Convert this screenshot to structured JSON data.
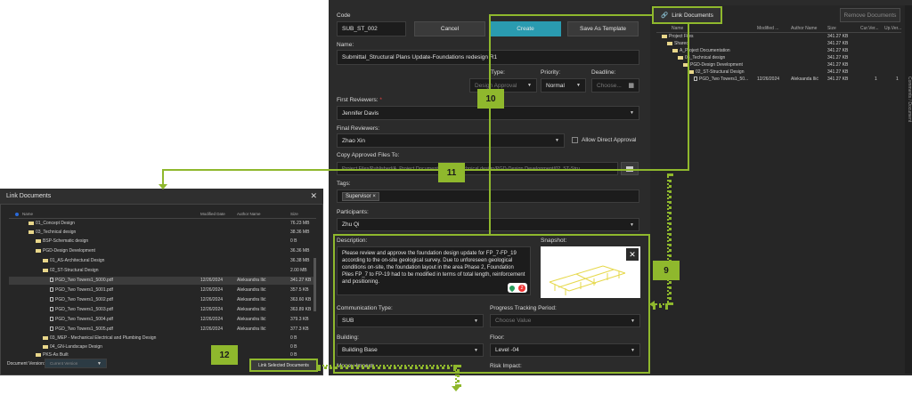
{
  "main": {
    "code_label": "Code",
    "code_value": "SUB_ST_002",
    "cancel": "Cancel",
    "create": "Create",
    "save_template": "Save As Template",
    "name_label": "Name:",
    "name_value": "Submittal_Structural Plans Update-Foundations redesign R1",
    "type_label": "Type:",
    "type_value": "Design Approval",
    "priority_label": "Priority:",
    "priority_value": "Normal",
    "deadline_label": "Deadline:",
    "deadline_value": "Choose...",
    "first_rev_label": "First Reviewers:",
    "first_rev_value": "Jennifer Davis",
    "final_rev_label": "Final Reviewers:",
    "final_rev_value": "Zhao  Xin",
    "allow_direct": "Allow Direct Approval",
    "copy_label": "Copy Approved Files To:",
    "copy_value": "Project Files/Published/A_Project Documentation/03_Technical design/PGD-Design Development/02_ST-Stru",
    "tags_label": "Tags:",
    "tag1": "Supervisor",
    "participants_label": "Participants:",
    "participants_value": "Zhu  Qi",
    "desc_label": "Description:",
    "desc_text": "Please review and approve the foundation design update for FP_7-FP_19 according to the on-site geological survey. Due to unforeseen geological conditions on-site, the foundation layout in the area Phase 2, Foundation Piles FP_7 to FP-19 had to be modified in terms of total length, reinforcement and positioning.",
    "snapshot_label": "Snapshot:",
    "comm_label": "Communication Type:",
    "comm_value": "SUB",
    "progress_label": "Progress Tracking Period:",
    "progress_value": "Choose Value",
    "building_label": "Building:",
    "building_value": "Building Base",
    "floor_label": "Floor:",
    "floor_value": "Level -04",
    "money_label": "Money Impact:",
    "risk_label": "Risk Impact:",
    "pin_count": "2"
  },
  "right": {
    "link_btn": "Link Documents",
    "remove_btn": "Remove Documents",
    "columns": [
      "Name",
      "Modified ...",
      "Author Name",
      "Size",
      "Cur.Ver...",
      "Up.Ver..."
    ],
    "rows": [
      {
        "name": "Project Files",
        "mod": "",
        "author": "",
        "size": "341.27 KB",
        "cur": "",
        "up": ""
      },
      {
        "name": "Shared",
        "mod": "",
        "author": "",
        "size": "341.27 KB",
        "cur": "",
        "up": ""
      },
      {
        "name": "A_Project Documentation",
        "mod": "",
        "author": "",
        "size": "341.27 KB",
        "cur": "",
        "up": ""
      },
      {
        "name": "03_Technical design",
        "mod": "",
        "author": "",
        "size": "341.27 KB",
        "cur": "",
        "up": ""
      },
      {
        "name": "PGD-Design Development",
        "mod": "",
        "author": "",
        "size": "341.27 KB",
        "cur": "",
        "up": ""
      },
      {
        "name": "02_ST-Structural Design",
        "mod": "",
        "author": "",
        "size": "341.27 KB",
        "cur": "",
        "up": ""
      },
      {
        "name": "PGD_Two Towers1_50...",
        "mod": "12/26/2024",
        "author": "Aleksanda Ilić",
        "size": "341.27 KB",
        "cur": "1",
        "up": "1"
      }
    ]
  },
  "dialog": {
    "title": "Link Documents",
    "columns": [
      "Name",
      "Modified Date",
      "Author Name",
      "Size"
    ],
    "rows": [
      {
        "name": "01_Concept Design",
        "mod": "",
        "author": "",
        "size": "76.23 MB"
      },
      {
        "name": "03_Technical design",
        "mod": "",
        "author": "",
        "size": "38.36 MB"
      },
      {
        "name": "BSP-Schematic design",
        "mod": "",
        "author": "",
        "size": "0 B"
      },
      {
        "name": "PGD-Design Development",
        "mod": "",
        "author": "",
        "size": "36.36 MB"
      },
      {
        "name": "01_AS-Architectural Design",
        "mod": "",
        "author": "",
        "size": "36.38 MB"
      },
      {
        "name": "02_ST-Structural Design",
        "mod": "",
        "author": "",
        "size": "2.00 MB"
      },
      {
        "name": "PGD_Two Towers1_5000.pdf",
        "mod": "12/26/2024",
        "author": "Aleksandra Ilić",
        "size": "341.27 KB"
      },
      {
        "name": "PGD_Two Towers1_5001.pdf",
        "mod": "12/26/2024",
        "author": "Aleksandra Ilić",
        "size": "357.5 KB"
      },
      {
        "name": "PGD_Two Towers1_5002.pdf",
        "mod": "12/26/2024",
        "author": "Aleksandra Ilić",
        "size": "363.60 KB"
      },
      {
        "name": "PGD_Two Towers1_5003.pdf",
        "mod": "12/26/2024",
        "author": "Aleksandra Ilić",
        "size": "363.89 KB"
      },
      {
        "name": "PGD_Two Towers1_5004.pdf",
        "mod": "12/26/2024",
        "author": "Aleksandra Ilić",
        "size": "379.3 KB"
      },
      {
        "name": "PGD_Two Towers1_5005.pdf",
        "mod": "12/26/2024",
        "author": "Aleksandra Ilić",
        "size": "377.3 KB"
      },
      {
        "name": "03_MEP - Mechanical Electrical and Plumbing Design",
        "mod": "",
        "author": "",
        "size": "0 B"
      },
      {
        "name": "04_GN-Landscape Design",
        "mod": "",
        "author": "",
        "size": "0 B"
      },
      {
        "name": "PKS-As Built",
        "mod": "",
        "author": "",
        "size": "0 B"
      }
    ],
    "doc_version_label": "Document Version:",
    "doc_version_value": "Current Version",
    "link_selected": "Link Selected Documents"
  },
  "badges": {
    "b9": "9",
    "b10": "10",
    "b11": "11",
    "b12": "12"
  },
  "side_tab": "Comments / Document",
  "colors": {
    "accent": "#8fb82d",
    "create": "#2a9bb0",
    "panel": "#2b2b2b"
  }
}
